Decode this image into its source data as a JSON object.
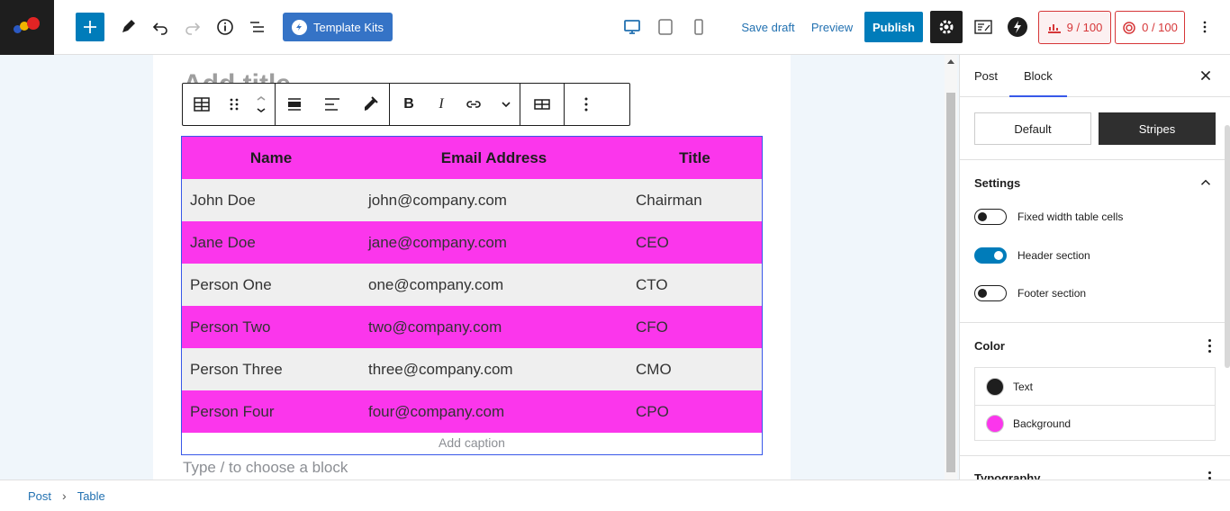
{
  "topbar": {
    "template_kits_label": "Template Kits",
    "save_draft_label": "Save draft",
    "preview_label": "Preview",
    "publish_label": "Publish",
    "seo_score": "9 / 100",
    "readability_score": "0 / 100"
  },
  "editor": {
    "title_ghost": "Add title",
    "appender_placeholder": "Type / to choose a block",
    "block_toolbar": {
      "bold": "B",
      "italic": "I"
    },
    "table": {
      "headers": [
        "Name",
        "Email Address",
        "Title"
      ],
      "rows": [
        [
          "John Doe",
          "john@company.com",
          "Chairman"
        ],
        [
          "Jane Doe",
          "jane@company.com",
          "CEO"
        ],
        [
          "Person One",
          "one@company.com",
          "CTO"
        ],
        [
          "Person Two",
          "two@company.com",
          "CFO"
        ],
        [
          "Person Three",
          "three@company.com",
          "CMO"
        ],
        [
          "Person Four",
          "four@company.com",
          "CPO"
        ]
      ],
      "caption_placeholder": "Add caption",
      "header_color": "#fb36ec",
      "stripe_color": "#efefef"
    }
  },
  "sidebar": {
    "tabs": [
      {
        "label": "Post"
      },
      {
        "label": "Block"
      }
    ],
    "styles": {
      "default_label": "Default",
      "stripes_label": "Stripes"
    },
    "settings": {
      "title": "Settings",
      "toggles": [
        {
          "label": "Fixed width table cells",
          "on": false
        },
        {
          "label": "Header section",
          "on": true
        },
        {
          "label": "Footer section",
          "on": false
        }
      ]
    },
    "color": {
      "title": "Color",
      "items": [
        {
          "label": "Text",
          "swatch": "#1e1e1e"
        },
        {
          "label": "Background",
          "swatch": "#fb36ec"
        }
      ]
    },
    "typography": {
      "title": "Typography"
    }
  },
  "breadcrumb": {
    "items": [
      "Post",
      "Table"
    ]
  },
  "colors": {
    "accent": "#007cba",
    "wp_blue": "#3858e9",
    "link": "#2271b1",
    "danger": "#d63638"
  }
}
